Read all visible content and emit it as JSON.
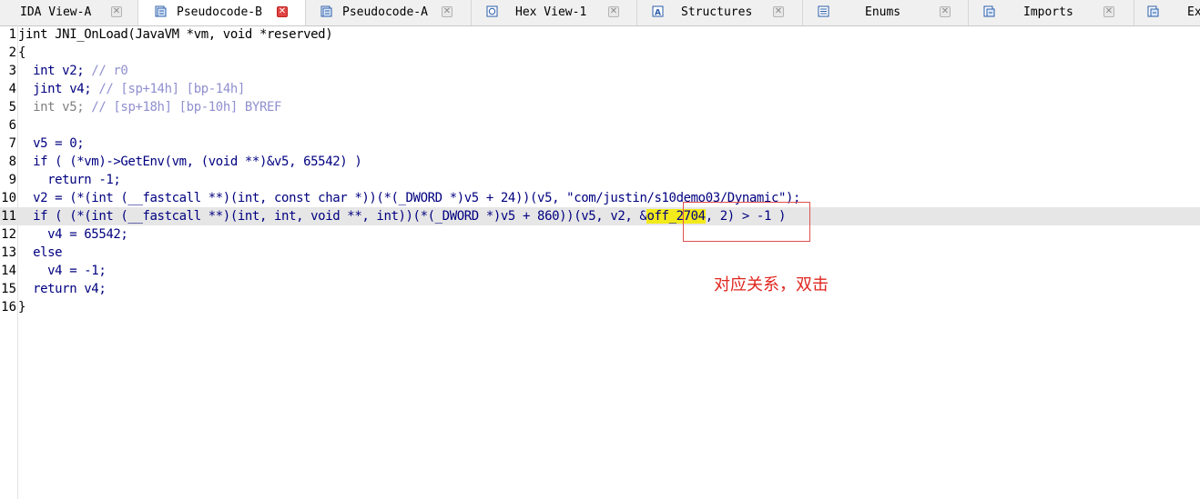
{
  "tabs": [
    {
      "label": "IDA View-A",
      "icon": "disasm-icon",
      "active": false
    },
    {
      "label": "Pseudocode-B",
      "icon": "pseudocode-icon",
      "active": true
    },
    {
      "label": "Pseudocode-A",
      "icon": "pseudocode-icon",
      "active": false
    },
    {
      "label": "Hex View-1",
      "icon": "hex-icon",
      "active": false
    },
    {
      "label": "Structures",
      "icon": "structures-icon",
      "active": false
    },
    {
      "label": "Enums",
      "icon": "enums-icon",
      "active": false
    },
    {
      "label": "Imports",
      "icon": "imports-icon",
      "active": false
    },
    {
      "label": "Ex",
      "icon": "exports-icon",
      "active": false
    }
  ],
  "code": {
    "line_numbers": [
      "1",
      "2",
      "3",
      "4",
      "5",
      "6",
      "7",
      "8",
      "9",
      "10",
      "11",
      "12",
      "13",
      "14",
      "15",
      "16"
    ],
    "current_line": 11,
    "text": {
      "l1_signature": "jint JNI_OnLoad(JavaVM *vm, void *reserved)",
      "brace_open": "{",
      "l3_decl": "int v2;",
      "l3_comment": "// r0",
      "l4_decl": "jint v4;",
      "l4_comment": "// [sp+14h] [bp-14h]",
      "l5_decl": "int v5;",
      "l5_comment": "// [sp+18h] [bp-10h] BYREF",
      "l7": "v5 = 0;",
      "l8": "if ( (*vm)->GetEnv(vm, (void **)&v5, 65542) )",
      "l9": "return -1;",
      "l10": "v2 = (*(int (__fastcall **)(int, const char *))(*(_DWORD *)v5 + 24))(v5, \"com/justin/s10demo03/Dynamic\");",
      "l11_pre": "if ( (*(int (__fastcall **)(int, int, void **, int))(*(_DWORD *)v5 + 860))(v5, v2, &",
      "l11_symbol": "off_2704",
      "l11_post": ", 2) > -1 )",
      "l12": "v4 = 65542;",
      "l13": "else",
      "l14": "v4 = -1;",
      "l15": "return v4;",
      "brace_close": "}"
    }
  },
  "annotation": {
    "text": "对应关系，双击",
    "color": "#e0261e"
  },
  "colors": {
    "keyword": "#000080",
    "variable": "#8080f0",
    "comment": "#9090d0",
    "highlight": "#f2ea1a"
  }
}
